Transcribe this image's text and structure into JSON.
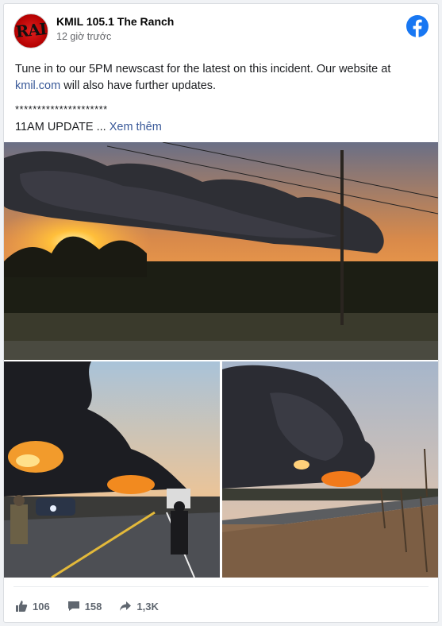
{
  "post": {
    "page_name": "KMIL 105.1 The Ranch",
    "time": "12 giờ trước",
    "avatar_text": "RAI",
    "line1_a": "Tune in to our 5PM newscast for the latest on this incident. Our website at",
    "link": "kmil.com",
    "line1_b": " will also have further updates.",
    "divider": "*********************",
    "update": "11AM UPDATE ... ",
    "see_more": "Xem thêm"
  },
  "stats": {
    "likes": "106",
    "comments": "158",
    "shares": "1,3K"
  },
  "colors": {
    "facebook_blue": "#1877f2",
    "link": "#385898"
  }
}
